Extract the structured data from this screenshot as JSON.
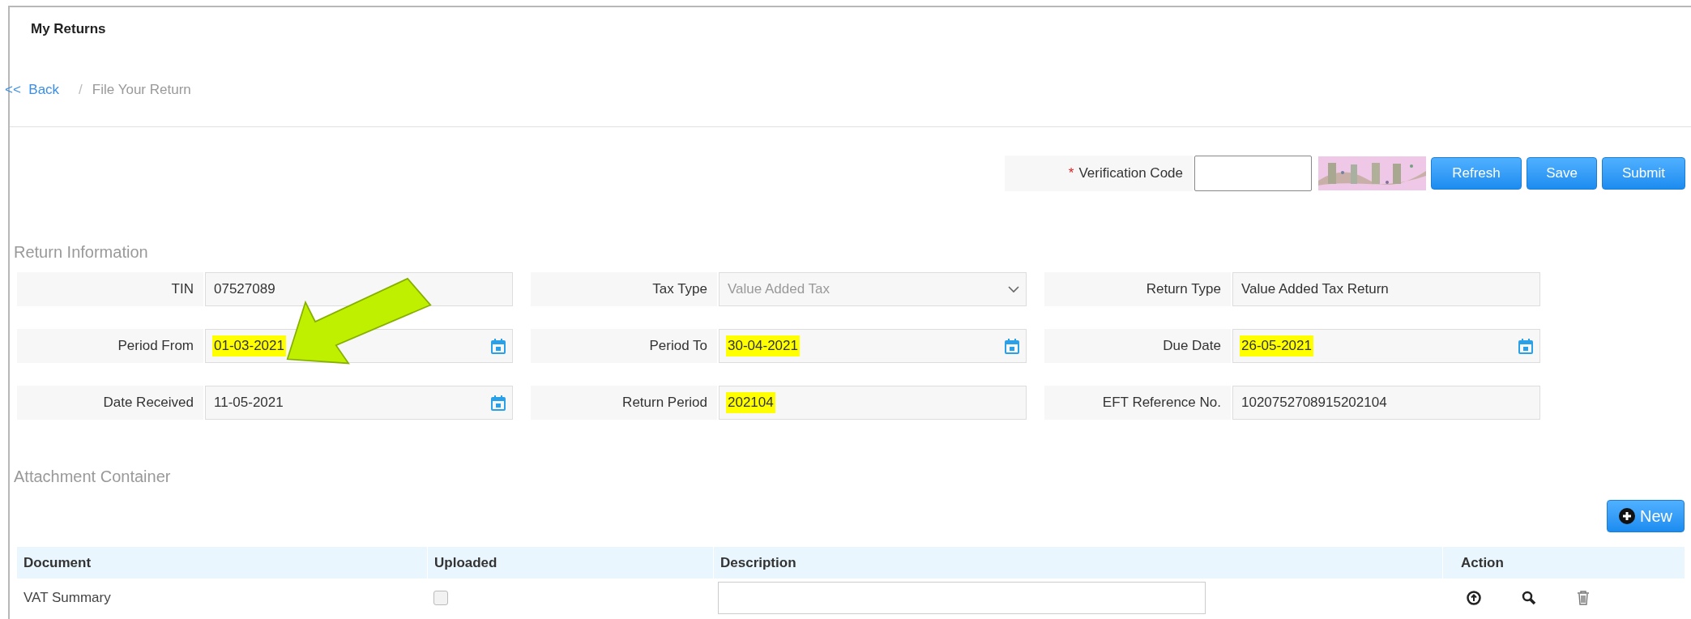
{
  "page_title": "My Returns",
  "breadcrumb": {
    "back": "<<  Back",
    "separator": "/",
    "current": "File Your Return"
  },
  "verification": {
    "required_mark": "*",
    "label": "Verification Code"
  },
  "actions": [
    {
      "label": "Refresh"
    },
    {
      "label": "Save"
    },
    {
      "label": "Submit"
    }
  ],
  "return_information": {
    "title": "Return Information",
    "fields": [
      {
        "label": "TIN",
        "value": "07527089",
        "kind": "text",
        "highlighted": false,
        "disabled": false
      },
      {
        "label": "Tax Type",
        "value": "Value Added Tax",
        "kind": "select",
        "highlighted": false,
        "disabled": true
      },
      {
        "label": "Return Type",
        "value": "Value Added Tax Return",
        "kind": "text",
        "highlighted": false,
        "disabled": false
      },
      {
        "label": "Period From",
        "value": "01-03-2021",
        "kind": "date",
        "highlighted": true,
        "disabled": false
      },
      {
        "label": "Period To",
        "value": "30-04-2021",
        "kind": "date",
        "highlighted": true,
        "disabled": false
      },
      {
        "label": "Due Date",
        "value": "26-05-2021",
        "kind": "date",
        "highlighted": true,
        "disabled": false
      },
      {
        "label": "Date Received",
        "value": "11-05-2021",
        "kind": "date",
        "highlighted": false,
        "disabled": false
      },
      {
        "label": "Return Period",
        "value": "202104",
        "kind": "text",
        "highlighted": true,
        "disabled": false
      },
      {
        "label": "EFT Reference No.",
        "value": "1020752708915202104",
        "kind": "text",
        "highlighted": false,
        "disabled": false
      }
    ]
  },
  "attachments": {
    "title": "Attachment Container",
    "new_button": "New",
    "columns": [
      "Document",
      "Uploaded",
      "Description",
      "Action"
    ],
    "rows": [
      {
        "document": "VAT Summary",
        "uploaded": false
      }
    ]
  }
}
